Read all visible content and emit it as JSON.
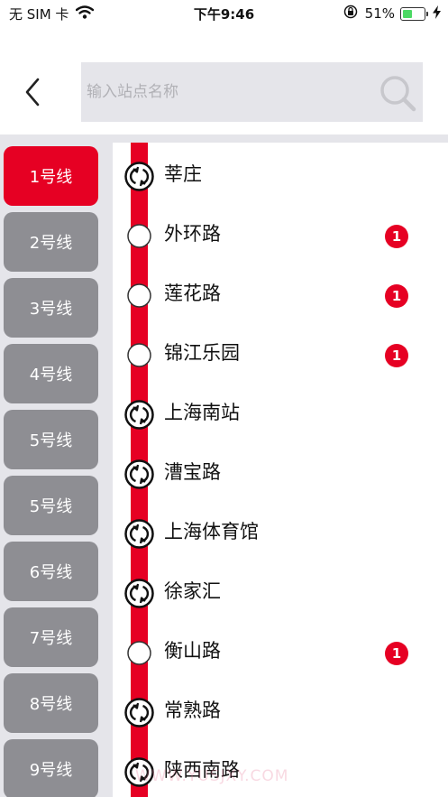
{
  "status_bar": {
    "carrier": "无 SIM 卡",
    "time": "下午9:46",
    "battery_percent": "51%",
    "battery_level": 0.51,
    "battery_color": "#4cd964"
  },
  "header": {
    "back_icon": "chevron-left-icon",
    "search_placeholder": "输入站点名称",
    "search_value": "",
    "search_icon": "search-icon"
  },
  "colors": {
    "accent": "#e60023",
    "inactive_button": "#8e8e93",
    "panel_background": "#e5e5ea"
  },
  "lines": [
    {
      "label": "1号线",
      "active": true
    },
    {
      "label": "2号线",
      "active": false
    },
    {
      "label": "3号线",
      "active": false
    },
    {
      "label": "4号线",
      "active": false
    },
    {
      "label": "5号线",
      "active": false
    },
    {
      "label": "5号线",
      "active": false
    },
    {
      "label": "6号线",
      "active": false
    },
    {
      "label": "7号线",
      "active": false
    },
    {
      "label": "8号线",
      "active": false
    },
    {
      "label": "9号线",
      "active": false
    }
  ],
  "stations": [
    {
      "name": "莘庄",
      "transfer": true,
      "badge": ""
    },
    {
      "name": "外环路",
      "transfer": false,
      "badge": "1"
    },
    {
      "name": "莲花路",
      "transfer": false,
      "badge": "1"
    },
    {
      "name": "锦江乐园",
      "transfer": false,
      "badge": "1"
    },
    {
      "name": "上海南站",
      "transfer": true,
      "badge": ""
    },
    {
      "name": "漕宝路",
      "transfer": true,
      "badge": ""
    },
    {
      "name": "上海体育馆",
      "transfer": true,
      "badge": ""
    },
    {
      "name": "徐家汇",
      "transfer": true,
      "badge": ""
    },
    {
      "name": "衡山路",
      "transfer": false,
      "badge": "1"
    },
    {
      "name": "常熟路",
      "transfer": true,
      "badge": ""
    },
    {
      "name": "陕西南路",
      "transfer": true,
      "badge": ""
    }
  ],
  "watermark": "WWW.YUSJXY.COM"
}
